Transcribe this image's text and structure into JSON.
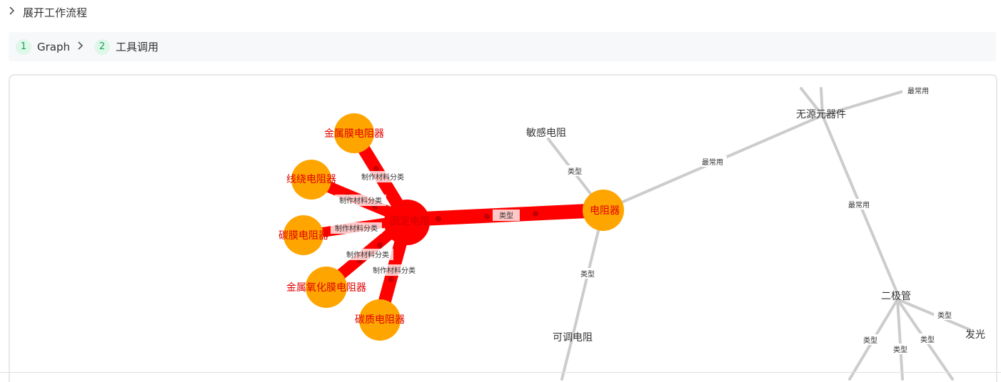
{
  "expander": {
    "label": "展开工作流程"
  },
  "steps": [
    {
      "num": "1",
      "label": "Graph"
    },
    {
      "num": "2",
      "label": "工具调用"
    }
  ],
  "graph": {
    "highlight_color": "#ff0000",
    "node_color": "#ffa500",
    "edge_color": "#cccccc",
    "nodes": {
      "jinshumo": "金属膜电阻器",
      "xianrao": "线绕电阻器",
      "tanmo": "碳膜电阻器",
      "yanghuamo": "金属氧化膜电阻器",
      "tanzhi": "碳质电阻器",
      "guding": "固定电阻",
      "dianzuqi": "电阻器",
      "mingan": "敏感电阻",
      "ketiao": "可调电阻",
      "wuyuan": "无源元器件",
      "erjiguan": "二极管",
      "fa": "发光"
    },
    "edge_labels": {
      "material": "制作材料分类",
      "type": "类型",
      "common": "最常用"
    }
  }
}
